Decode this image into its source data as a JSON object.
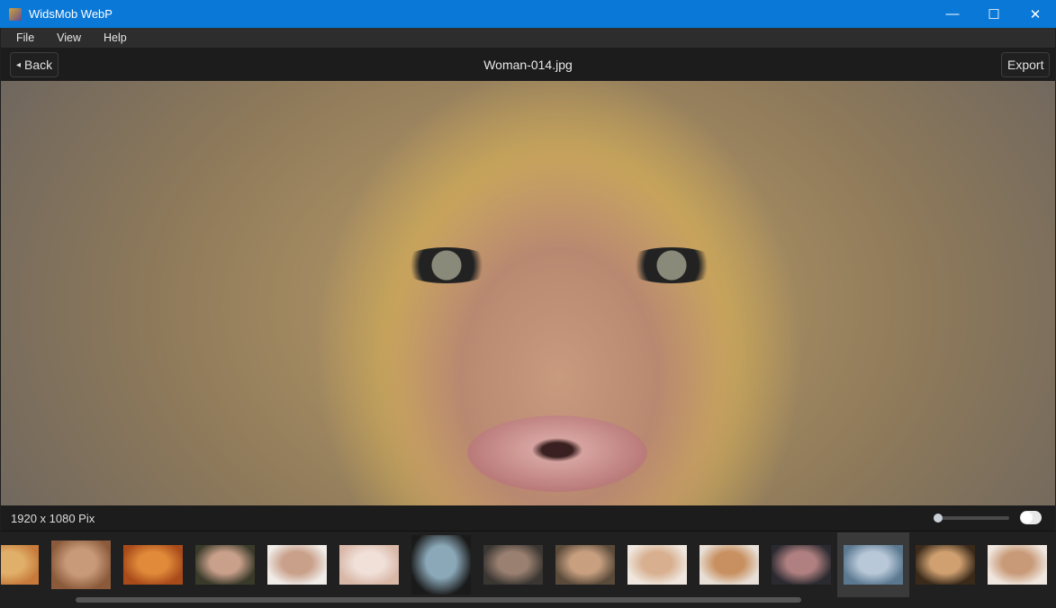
{
  "window": {
    "title": "WidsMob WebP",
    "minimize": "—",
    "maximize": "☐",
    "close": "✕"
  },
  "menu": [
    "File",
    "View",
    "Help"
  ],
  "toolbar": {
    "back_label": "Back",
    "back_icon": "◂",
    "file_name": "Woman-014.jpg",
    "export_label": "Export"
  },
  "status": {
    "dimensions": "1920 x 1080 Pix",
    "zoom_percent": 0,
    "toggle_on": true
  },
  "thumbnails": [
    {
      "c1": "#c77a3a",
      "c2": "#e0b06a"
    },
    {
      "c1": "#8a5a3a",
      "c2": "#c99a7a",
      "big": true
    },
    {
      "c1": "#a84a1a",
      "c2": "#e08a3a"
    },
    {
      "c1": "#3a3a2a",
      "c2": "#c9a08a"
    },
    {
      "c1": "#f0ece8",
      "c2": "#c9a08a"
    },
    {
      "c1": "#d9b8a8",
      "c2": "#f0e0d8"
    },
    {
      "c1": "#1a1a1a",
      "c2": "#8aa8b8",
      "tall": true
    },
    {
      "c1": "#3a3632",
      "c2": "#9a8070"
    },
    {
      "c1": "#5a4a3a",
      "c2": "#c8a080"
    },
    {
      "c1": "#f0e8e0",
      "c2": "#d8b090"
    },
    {
      "c1": "#e8e0d8",
      "c2": "#c89060"
    },
    {
      "c1": "#2a2a30",
      "c2": "#b08080"
    },
    {
      "c1": "#5a7890",
      "c2": "#b8c8d8",
      "selected": true
    },
    {
      "c1": "#3a2a1a",
      "c2": "#d0a070"
    },
    {
      "c1": "#f0e8e0",
      "c2": "#c89a78"
    }
  ]
}
